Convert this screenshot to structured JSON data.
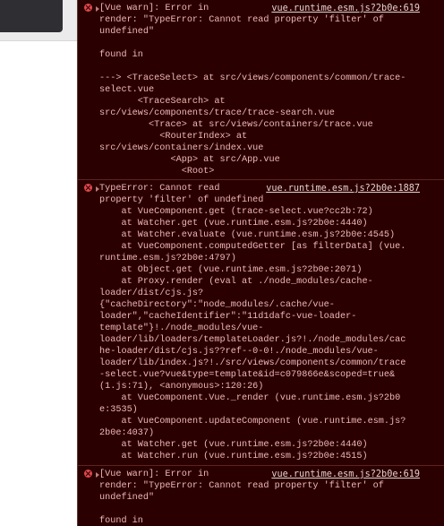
{
  "colors": {
    "console_bg": "#2a0000",
    "error_text": "#f1b6b6",
    "error_icon": "#e0484d",
    "divider": "#5e2222"
  },
  "entries": [
    {
      "icon": "error-icon",
      "link": "vue.runtime.esm.js?2b0e:619",
      "message": "[Vue warn]: Error in\nrender: \"TypeError: Cannot read property 'filter' of\nundefined\"\n\nfound in\n\n---> <TraceSelect> at src/views/components/common/trace-\nselect.vue\n       <TraceSearch> at\nsrc/views/components/trace/trace-search.vue\n         <Trace> at src/views/containers/trace.vue\n           <RouterIndex> at\nsrc/views/containers/index.vue\n             <App> at src/App.vue\n               <Root>"
    },
    {
      "icon": "error-icon",
      "link": "vue.runtime.esm.js?2b0e:1887",
      "message": "TypeError: Cannot read\nproperty 'filter' of undefined\n    at VueComponent.get (trace-select.vue?cc2b:72)\n    at Watcher.get (vue.runtime.esm.js?2b0e:4440)\n    at Watcher.evaluate (vue.runtime.esm.js?2b0e:4545)\n    at VueComponent.computedGetter [as filterData] (vue.\nruntime.esm.js?2b0e:4797)\n    at Object.get (vue.runtime.esm.js?2b0e:2071)\n    at Proxy.render (eval at ./node_modules/cache-\nloader/dist/cjs.js?\n{\"cacheDirectory\":\"node_modules/.cache/vue-\nloader\",\"cacheIdentifier\":\"11d1dafc-vue-loader-\ntemplate\"}!./node_modules/vue-\nloader/lib/loaders/templateLoader.js?!./node_modules/cac\nhe-loader/dist/cjs.js??ref--0-0!./node_modules/vue-\nloader/lib/index.js?!./src/views/components/common/trace\n-select.vue?vue&type=template&id=c079866e&scoped=true&\n(1.js:71), <anonymous>:120:26)\n    at VueComponent.Vue._render (vue.runtime.esm.js?2b0\ne:3535)\n    at VueComponent.updateComponent (vue.runtime.esm.js?\n2b0e:4037)\n    at Watcher.get (vue.runtime.esm.js?2b0e:4440)\n    at Watcher.run (vue.runtime.esm.js?2b0e:4515)"
    },
    {
      "icon": "error-icon",
      "link": "vue.runtime.esm.js?2b0e:619",
      "message": "[Vue warn]: Error in\nrender: \"TypeError: Cannot read property 'filter' of\nundefined\"\n\nfound in"
    }
  ]
}
